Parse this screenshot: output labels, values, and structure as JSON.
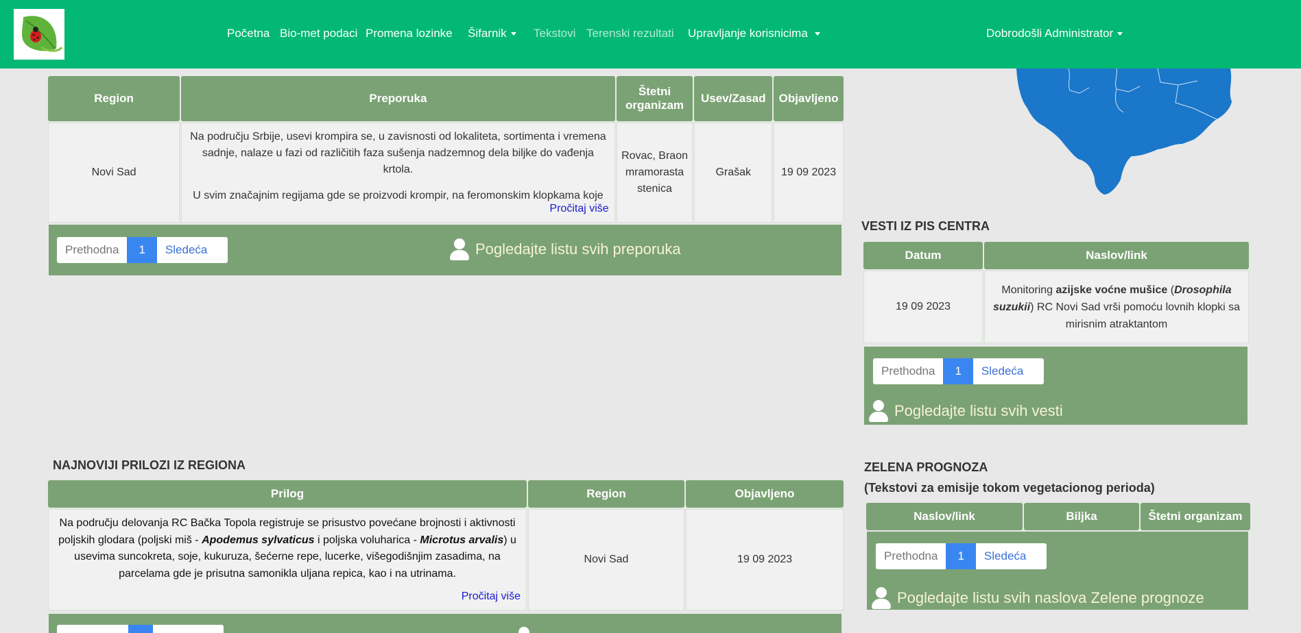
{
  "nav": {
    "items": [
      {
        "label": "Početna"
      },
      {
        "label": "Bio-met podaci"
      },
      {
        "label": "Promena lozinke"
      },
      {
        "label": "Šifarnik"
      },
      {
        "label": "Tekstovi"
      },
      {
        "label": "Terenski rezultati"
      },
      {
        "label": "Upravljanje korisnicima"
      }
    ],
    "user_menu": "Dobrodošli Administrator"
  },
  "recommendations": {
    "headers": [
      "Region",
      "Preporuka",
      "Štetni organizam",
      "Usev/Zasad",
      "Objavljeno"
    ],
    "row": {
      "region": "Novi Sad",
      "text_p1": "Na području Srbije, usevi  krompira se, u zavisnosti od lokaliteta, sortimenta i vremena sadnje, nalaze u fazi od različitih faza sušenja nadzemnog dela biljke do vađenja krtola.",
      "text_p2": "U svim značajnim regijama gde se proizvodi krompir, na feromonskim klopkama koje",
      "read_more": "Pročitaj više",
      "organism": "Rovac, Braon mramorasta stenica",
      "crop": "Grašak",
      "date": "19 09 2023"
    },
    "pager": {
      "prev": "Prethodna",
      "page": "1",
      "next": "Sledeća"
    },
    "list_link": "Pogledajte listu svih preporuka"
  },
  "news": {
    "title": "VESTI IZ PIS CENTRA",
    "headers": [
      "Datum",
      "Naslov/link"
    ],
    "row": {
      "date": "19 09 2023",
      "t1": "Monitoring ",
      "t2": "azijske voćne mušice",
      "t3": " (",
      "t4": "Drosophila suzukii",
      "t5": ") RC Novi Sad vrši pomoću lovnih klopki sa mirisnim atraktantom"
    },
    "pager": {
      "prev": "Prethodna",
      "page": "1",
      "next": "Sledeća"
    },
    "list_link": "Pogledajte listu svih vesti"
  },
  "regional": {
    "title": "NAJNOVIJI PRILOZI IZ REGIONA",
    "headers": [
      "Prilog",
      "Region",
      "Objavljeno"
    ],
    "row": {
      "t1": "Na području delovanja RC Bačka Topola registruje se prisustvo povećane brojnosti i aktivnosti poljskih glodara (poljski miš - ",
      "t2": "Apodemus sylvaticus",
      "t3": " i poljska voluharica - ",
      "t4": "Microtus arvalis",
      "t5": ") u usevima suncokreta, soje, kukuruza, šećerne repe, lucerke, višegodišnjim zasadima, na parcelama gde je prisutna samonikla uljana repica, kao i na utrinama.",
      "read_more": "Pročitaj više",
      "region": "Novi Sad",
      "date": "19 09 2023"
    }
  },
  "green_forecast": {
    "title": "ZELENA PROGNOZA",
    "subtitle": "(Tekstovi za emisije tokom vegetacionog perioda)",
    "headers": [
      "Naslov/link",
      "Biljka",
      "Štetni organizam"
    ],
    "pager": {
      "prev": "Prethodna",
      "page": "1",
      "next": "Sledeća"
    },
    "list_link": "Pogledajte listu svih naslova Zelene prognoze"
  },
  "colors": {
    "navbar": "#02b874",
    "table_header": "#7ba274",
    "map": "#1a77c9",
    "pager_active": "#3a86f0"
  }
}
